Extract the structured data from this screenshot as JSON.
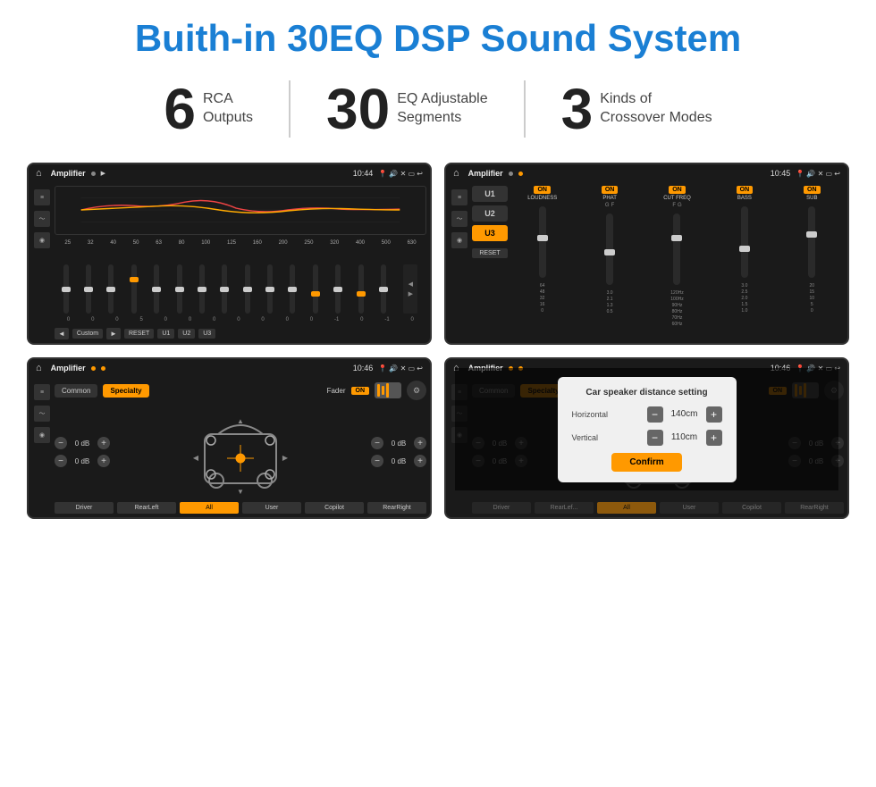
{
  "page": {
    "title": "Buith-in 30EQ DSP Sound System",
    "stats": [
      {
        "number": "6",
        "text": "RCA\nOutputs"
      },
      {
        "number": "30",
        "text": "EQ Adjustable\nSegments"
      },
      {
        "number": "3",
        "text": "Kinds of\nCrossover Modes"
      }
    ],
    "screens": [
      {
        "id": "screen1",
        "status_bar": {
          "app": "Amplifier",
          "time": "10:44"
        },
        "type": "eq",
        "frequencies": [
          "25",
          "32",
          "40",
          "50",
          "63",
          "80",
          "100",
          "125",
          "160",
          "200",
          "250",
          "320",
          "400",
          "500",
          "630"
        ],
        "sliders": [
          0,
          0,
          0,
          5,
          0,
          0,
          0,
          0,
          0,
          0,
          0,
          -1,
          0,
          -1,
          0
        ],
        "controls": [
          "◄",
          "Custom",
          "►",
          "RESET",
          "U1",
          "U2",
          "U3"
        ]
      },
      {
        "id": "screen2",
        "status_bar": {
          "app": "Amplifier",
          "time": "10:45"
        },
        "type": "crossover",
        "presets": [
          "U1",
          "U2",
          "U3"
        ],
        "active_preset": "U3",
        "columns": [
          {
            "label": "LOUDNESS",
            "on": true
          },
          {
            "label": "PHAT",
            "on": true
          },
          {
            "label": "CUT FREQ",
            "on": true
          },
          {
            "label": "BASS",
            "on": true
          },
          {
            "label": "SUB",
            "on": true
          }
        ],
        "reset_label": "RESET"
      },
      {
        "id": "screen3",
        "status_bar": {
          "app": "Amplifier",
          "time": "10:46"
        },
        "type": "fader",
        "tabs": [
          "Common",
          "Specialty"
        ],
        "active_tab": "Specialty",
        "fader_label": "Fader",
        "fader_on": "ON",
        "db_values": [
          "0 dB",
          "0 dB",
          "0 dB",
          "0 dB"
        ],
        "bottom_btns": [
          "Driver",
          "RearLeft",
          "All",
          "User",
          "Copilot",
          "RearRight"
        ]
      },
      {
        "id": "screen4",
        "status_bar": {
          "app": "Amplifier",
          "time": "10:46"
        },
        "type": "distance",
        "dialog": {
          "title": "Car speaker distance setting",
          "horizontal_label": "Horizontal",
          "horizontal_value": "140cm",
          "vertical_label": "Vertical",
          "vertical_value": "110cm",
          "confirm_label": "Confirm"
        },
        "tabs": [
          "Common",
          "Specialty"
        ],
        "active_tab": "Specialty",
        "bottom_btns": [
          "Driver",
          "RearLef...",
          "All",
          "User",
          "Copilot",
          "RearRight"
        ]
      }
    ]
  }
}
